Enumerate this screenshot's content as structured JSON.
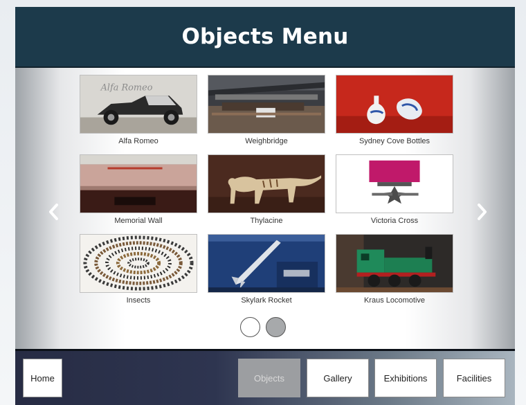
{
  "header": {
    "title": "Objects Menu"
  },
  "objects": [
    {
      "label": "Alfa Romeo",
      "image": "vintage-car"
    },
    {
      "label": "Weighbridge",
      "image": "museum-hall"
    },
    {
      "label": "Sydney Cove Bottles",
      "image": "porcelain-bottles"
    },
    {
      "label": "Memorial Wall",
      "image": "memorial-wall"
    },
    {
      "label": "Thylacine",
      "image": "thylacine-specimen"
    },
    {
      "label": "Victoria Cross",
      "image": "victoria-cross-medal"
    },
    {
      "label": "Insects",
      "image": "insect-spiral"
    },
    {
      "label": "Skylark Rocket",
      "image": "rocket-display"
    },
    {
      "label": "Kraus Locomotive",
      "image": "green-locomotive"
    }
  ],
  "carousel": {
    "prev_icon": "chevron-left-icon",
    "next_icon": "chevron-right-icon",
    "pages": 2,
    "current_page": 2
  },
  "nav": {
    "home": "Home",
    "objects": "Objects",
    "gallery": "Gallery",
    "exhibitions": "Exhibitions",
    "facilities": "Facilities",
    "active": "Objects"
  },
  "colors": {
    "header_bg": "#1c3a4b",
    "active_nav": "#9c9ea1"
  }
}
